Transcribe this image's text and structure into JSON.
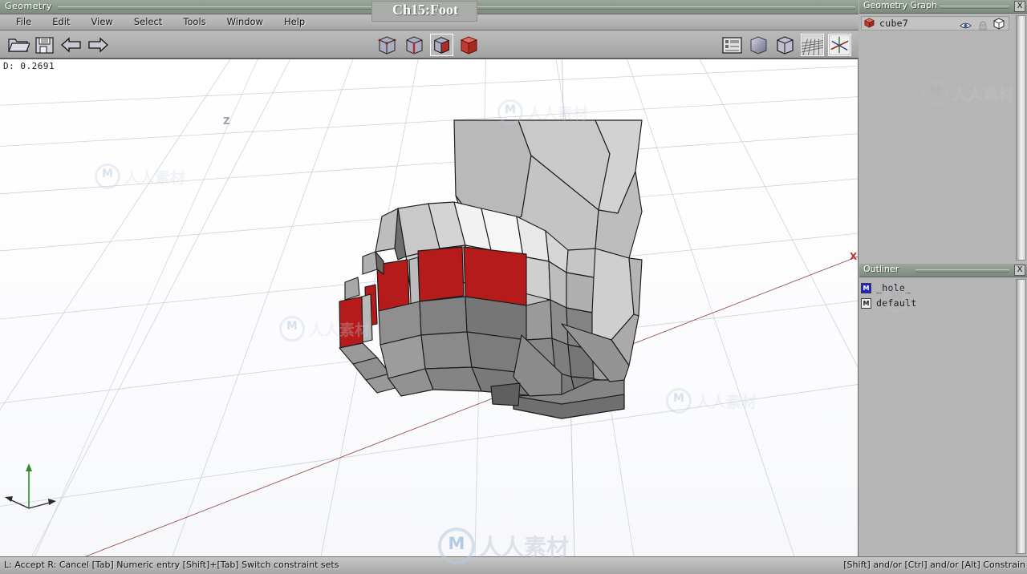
{
  "window": {
    "app_title": "Geometry",
    "document_title": "Ch15:Foot"
  },
  "menu": {
    "items": [
      {
        "label": "File"
      },
      {
        "label": "Edit"
      },
      {
        "label": "View"
      },
      {
        "label": "Select"
      },
      {
        "label": "Tools"
      },
      {
        "label": "Window"
      },
      {
        "label": "Help"
      }
    ]
  },
  "toolbar": {
    "left_buttons": [
      {
        "name": "open-folder-icon",
        "label": "Open"
      },
      {
        "name": "save-disk-icon",
        "label": "Save"
      },
      {
        "name": "undo-arrow-icon",
        "label": "Undo"
      },
      {
        "name": "redo-arrow-icon",
        "label": "Redo"
      }
    ],
    "select_mode_buttons": [
      {
        "name": "vertex-mode-icon",
        "label": "Vertex",
        "active": false
      },
      {
        "name": "edge-mode-icon",
        "label": "Edge",
        "active": false
      },
      {
        "name": "face-mode-icon",
        "label": "Face",
        "active": true
      },
      {
        "name": "body-mode-icon",
        "label": "Body",
        "active": false
      }
    ],
    "right_buttons": [
      {
        "name": "preferences-icon",
        "label": "Preferences",
        "active": false
      },
      {
        "name": "smooth-shade-icon",
        "label": "Smooth Shade",
        "active": false
      },
      {
        "name": "wireframe-icon",
        "label": "Wireframe",
        "active": false
      },
      {
        "name": "show-grid-icon",
        "label": "Show Grid",
        "active": true
      },
      {
        "name": "show-axes-icon",
        "label": "Show Axes",
        "active": true
      }
    ]
  },
  "viewport": {
    "distance_readout": "D: 0.2691",
    "axis_x_label": "X",
    "axis_z_label": "Z",
    "colors": {
      "background": "#fdfdfe",
      "selected_face": "#b51b1b",
      "axis_x": "#b03a3a",
      "axis_y": "#2e8b2e",
      "grid_line": "#c8cdd4"
    }
  },
  "geometry_graph": {
    "title": "Geometry Graph",
    "close_label": "X",
    "items": [
      {
        "name": "cube7",
        "visible_icon": "eye-icon",
        "lock_icon": "lock-icon",
        "wire_icon": "wireframe-cube-icon"
      }
    ]
  },
  "outliner": {
    "title": "Outliner",
    "close_label": "X",
    "items": [
      {
        "label": "_hole_",
        "swatch": "M",
        "swatch_color": "#2222cc"
      },
      {
        "label": "default",
        "swatch": "M",
        "swatch_color": "#f0f0f0"
      }
    ]
  },
  "statusbar": {
    "left": "L: Accept   R: Cancel    [Tab] Numeric entry    [Shift]+[Tab] Switch constraint sets",
    "right": "[Shift] and/or [Ctrl] and/or [Alt] Constrain"
  },
  "watermark": {
    "text": "人人素材"
  }
}
